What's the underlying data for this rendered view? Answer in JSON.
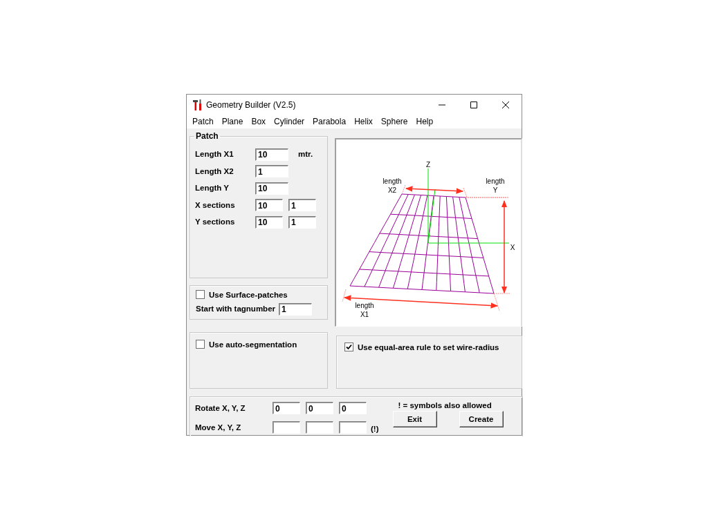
{
  "window": {
    "title": "Geometry Builder (V2.5)"
  },
  "menu": [
    {
      "label": "Patch"
    },
    {
      "label": "Plane"
    },
    {
      "label": "Box"
    },
    {
      "label": "Cylinder"
    },
    {
      "label": "Parabola"
    },
    {
      "label": "Helix"
    },
    {
      "label": "Sphere"
    },
    {
      "label": "Help"
    }
  ],
  "patch_group": {
    "title": "Patch",
    "rows": [
      {
        "label": "Length X1",
        "fields": [
          {
            "value": "10"
          }
        ],
        "unit": "mtr."
      },
      {
        "label": "Length X2",
        "fields": [
          {
            "value": "1"
          }
        ]
      },
      {
        "label": "Length Y",
        "fields": [
          {
            "value": "10"
          }
        ]
      },
      {
        "label": "X sections",
        "fields": [
          {
            "value": "10"
          },
          {
            "value": "1"
          }
        ]
      },
      {
        "label": "Y sections",
        "fields": [
          {
            "value": "10"
          },
          {
            "value": "1"
          }
        ]
      }
    ]
  },
  "surface_group": {
    "checkbox": {
      "label": "Use Surface-patches",
      "checked": false
    },
    "tag_label": "Start with tagnumber",
    "tag_value": "1"
  },
  "diagram": {
    "axis_labels": [
      "Z",
      "X"
    ],
    "dimension_labels": [
      "length\nX2",
      "length\nY",
      "length\nX1"
    ]
  },
  "auto_segmentation": {
    "label": "Use auto-segmentation",
    "checked": false
  },
  "equal_area": {
    "label": "Use equal-area rule to set wire-radius",
    "checked": true
  },
  "transform": {
    "note": "! =  symbols also allowed",
    "rows": [
      {
        "label": "Rotate X, Y, Z",
        "fields": [
          {
            "value": "0"
          },
          {
            "value": "0"
          },
          {
            "value": "0"
          }
        ]
      },
      {
        "label": "Move X, Y, Z",
        "suffix": "(!)"
      }
    ]
  },
  "buttons": [
    {
      "label": "Exit"
    },
    {
      "label": "Create"
    }
  ]
}
